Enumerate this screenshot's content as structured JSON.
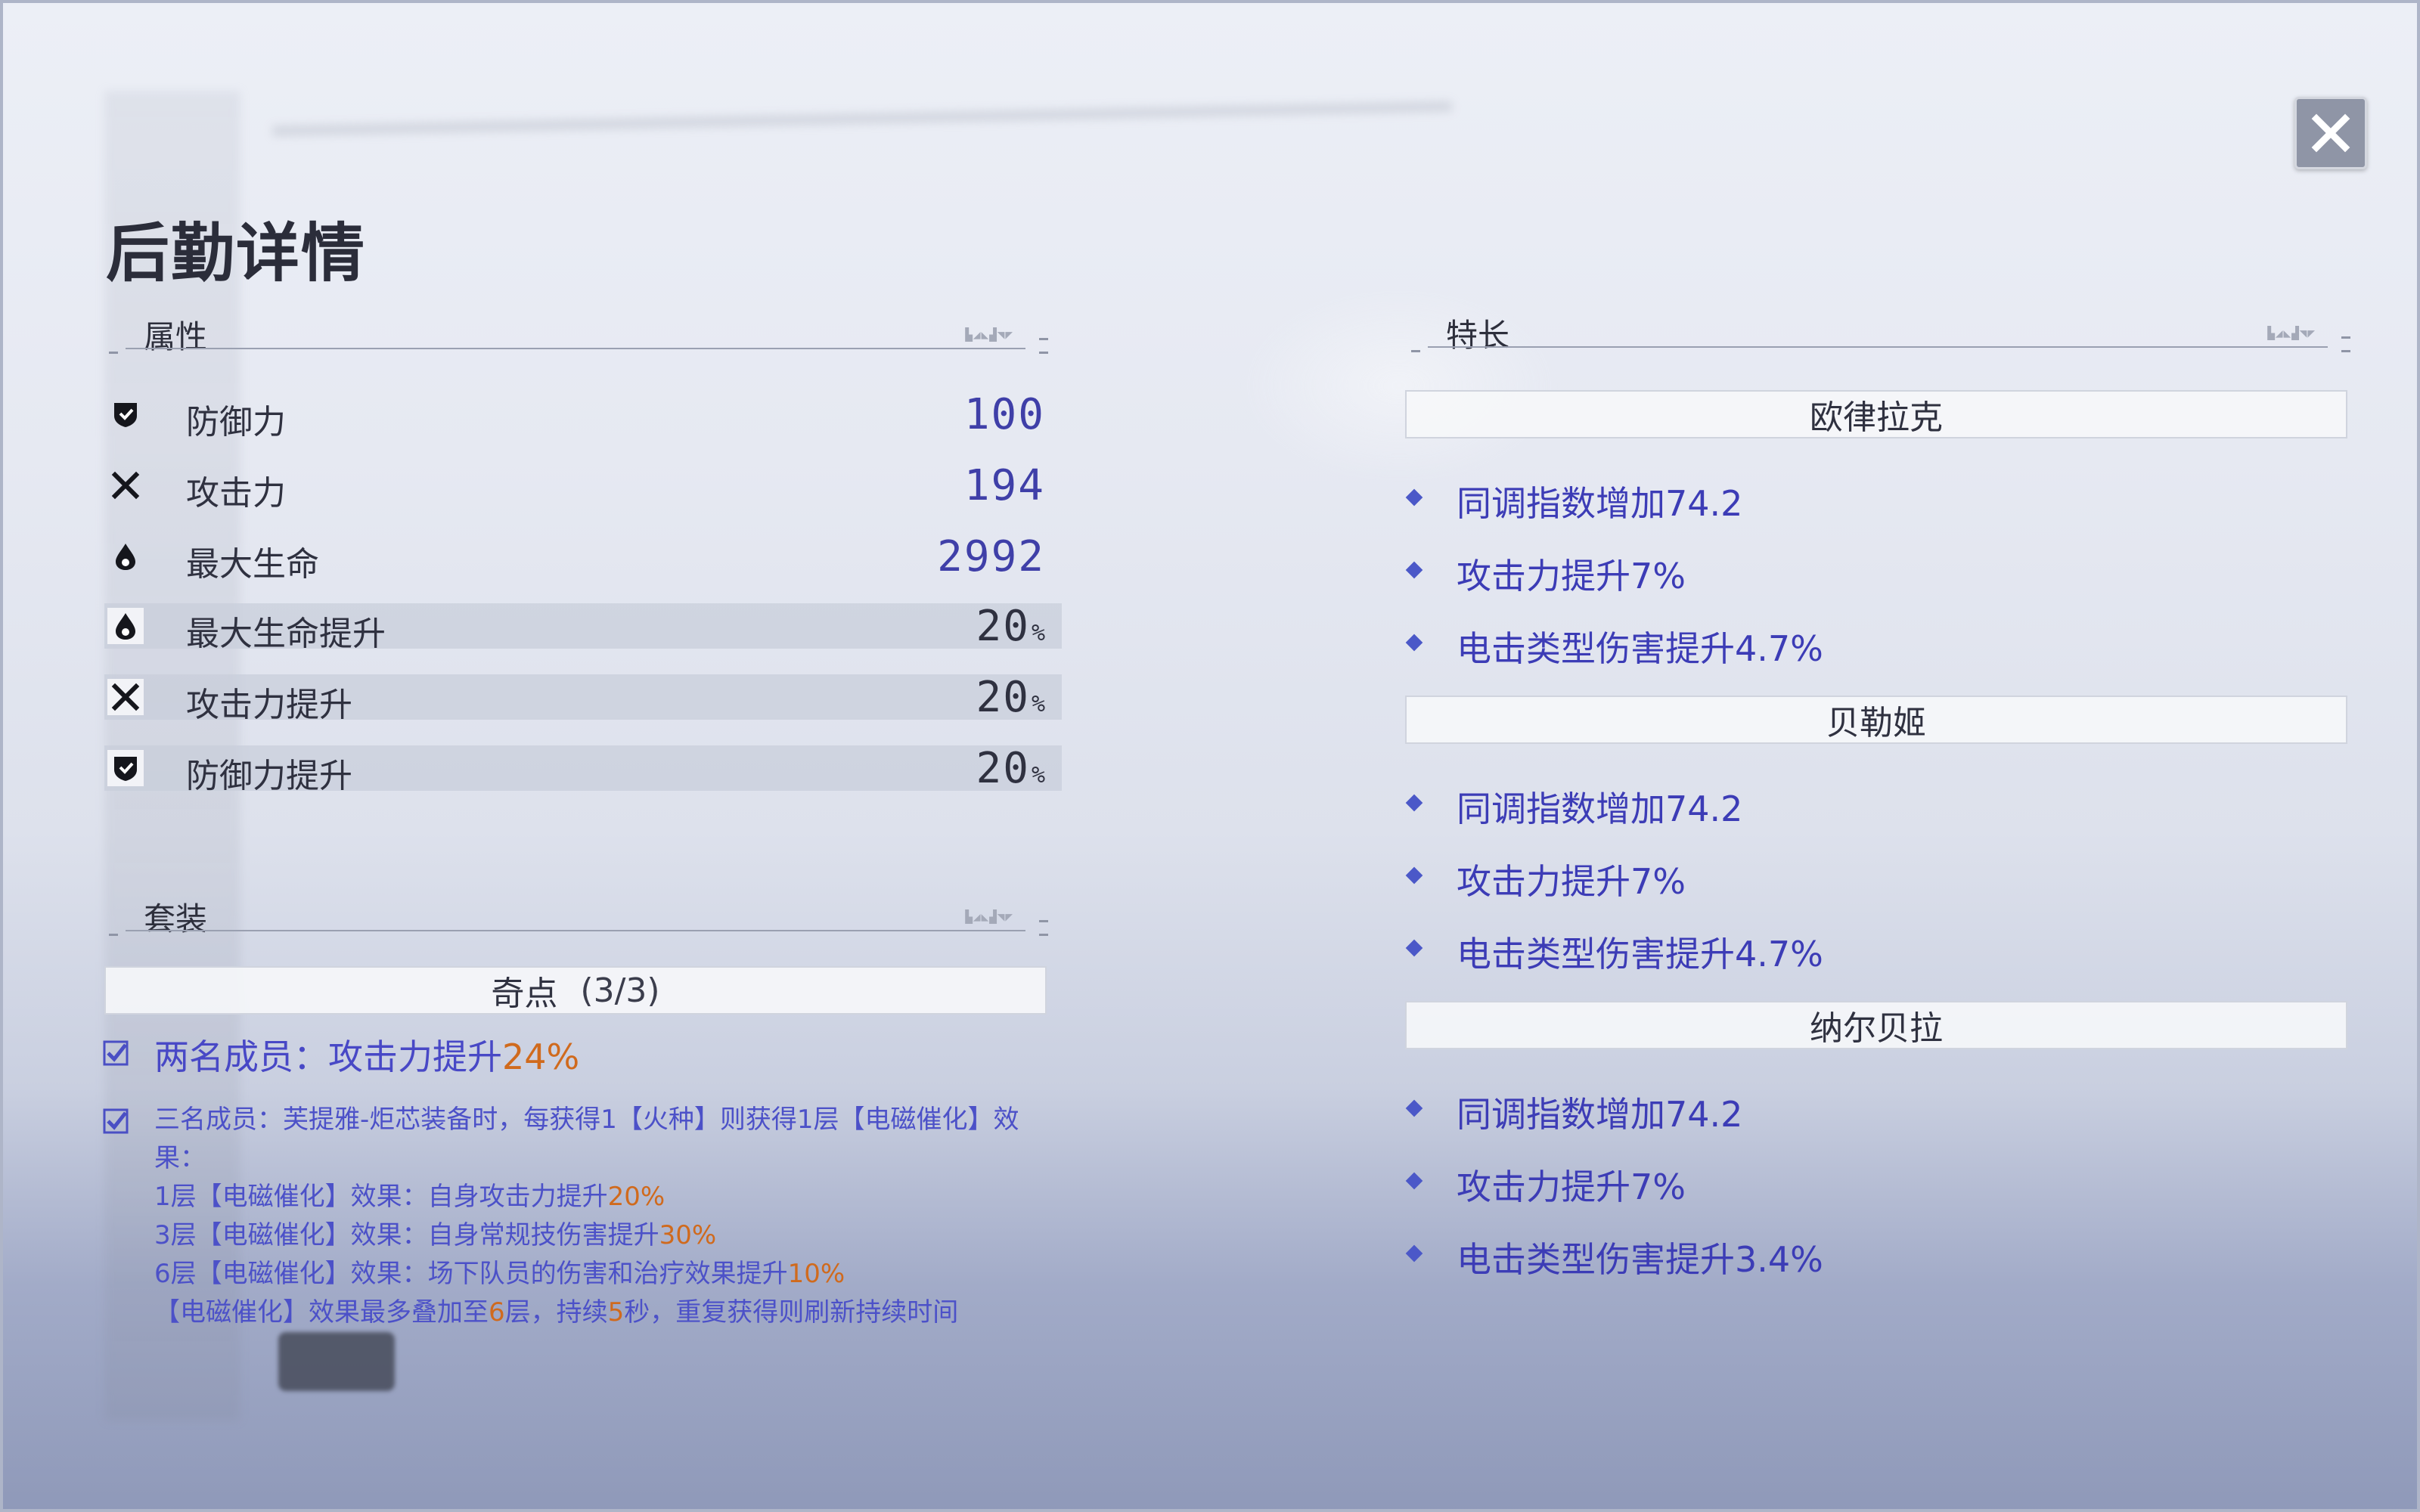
{
  "page_title": "后勤详情",
  "attributes": {
    "section_title": "属性",
    "deco": "▙◢◣▟◥◤",
    "stats": [
      {
        "icon": "shield-icon",
        "label": "防御力",
        "value": "100",
        "suffix": ""
      },
      {
        "icon": "crossed-swords-icon",
        "label": "攻击力",
        "value": "194",
        "suffix": ""
      },
      {
        "icon": "drop-icon",
        "label": "最大生命",
        "value": "2992",
        "suffix": ""
      },
      {
        "icon": "drop-icon",
        "label": "最大生命提升",
        "value": "20",
        "suffix": "%"
      },
      {
        "icon": "crossed-swords-icon",
        "label": "攻击力提升",
        "value": "20",
        "suffix": "%"
      },
      {
        "icon": "shield-icon",
        "label": "防御力提升",
        "value": "20",
        "suffix": "%"
      }
    ]
  },
  "set": {
    "section_title": "套装",
    "deco": "▙◢◣▟◥◤",
    "name": "奇点",
    "count": "(3/3)",
    "two_piece": {
      "prefix": "两名成员：攻击力提升",
      "value": "24%"
    },
    "three_piece": {
      "line1": "三名成员：芙提雅-炬芯装备时，每获得1【火种】则获得1层【电磁催化】效果：",
      "l2_prefix": "1层【电磁催化】效果：自身攻击力提升",
      "l2_value": "20%",
      "l3_prefix": "3层【电磁催化】效果：自身常规技伤害提升",
      "l3_value": "30%",
      "l4_prefix": "6层【电磁催化】效果：场下队员的伤害和治疗效果提升",
      "l4_value": "10%",
      "l5_a": "【电磁催化】效果最多叠加至",
      "l5_n1": "6",
      "l5_b": "层，持续",
      "l5_n2": "5",
      "l5_c": "秒，重复获得则刷新持续时间"
    }
  },
  "specialties": {
    "section_title": "特长",
    "deco": "▙◢◣▟◥◤",
    "groups": [
      {
        "name": "欧律拉克",
        "perks": [
          "同调指数增加74.2",
          "攻击力提升7%",
          "电击类型伤害提升4.7%"
        ]
      },
      {
        "name": "贝勒姬",
        "perks": [
          "同调指数增加74.2",
          "攻击力提升7%",
          "电击类型伤害提升4.7%"
        ]
      },
      {
        "name": "纳尔贝拉",
        "perks": [
          "同调指数增加74.2",
          "攻击力提升7%",
          "电击类型伤害提升3.4%"
        ]
      }
    ]
  },
  "colors": {
    "accent": "#3f3fa8",
    "highlight_number": "#d06a1d",
    "perk_text": "#3c3cb6"
  }
}
